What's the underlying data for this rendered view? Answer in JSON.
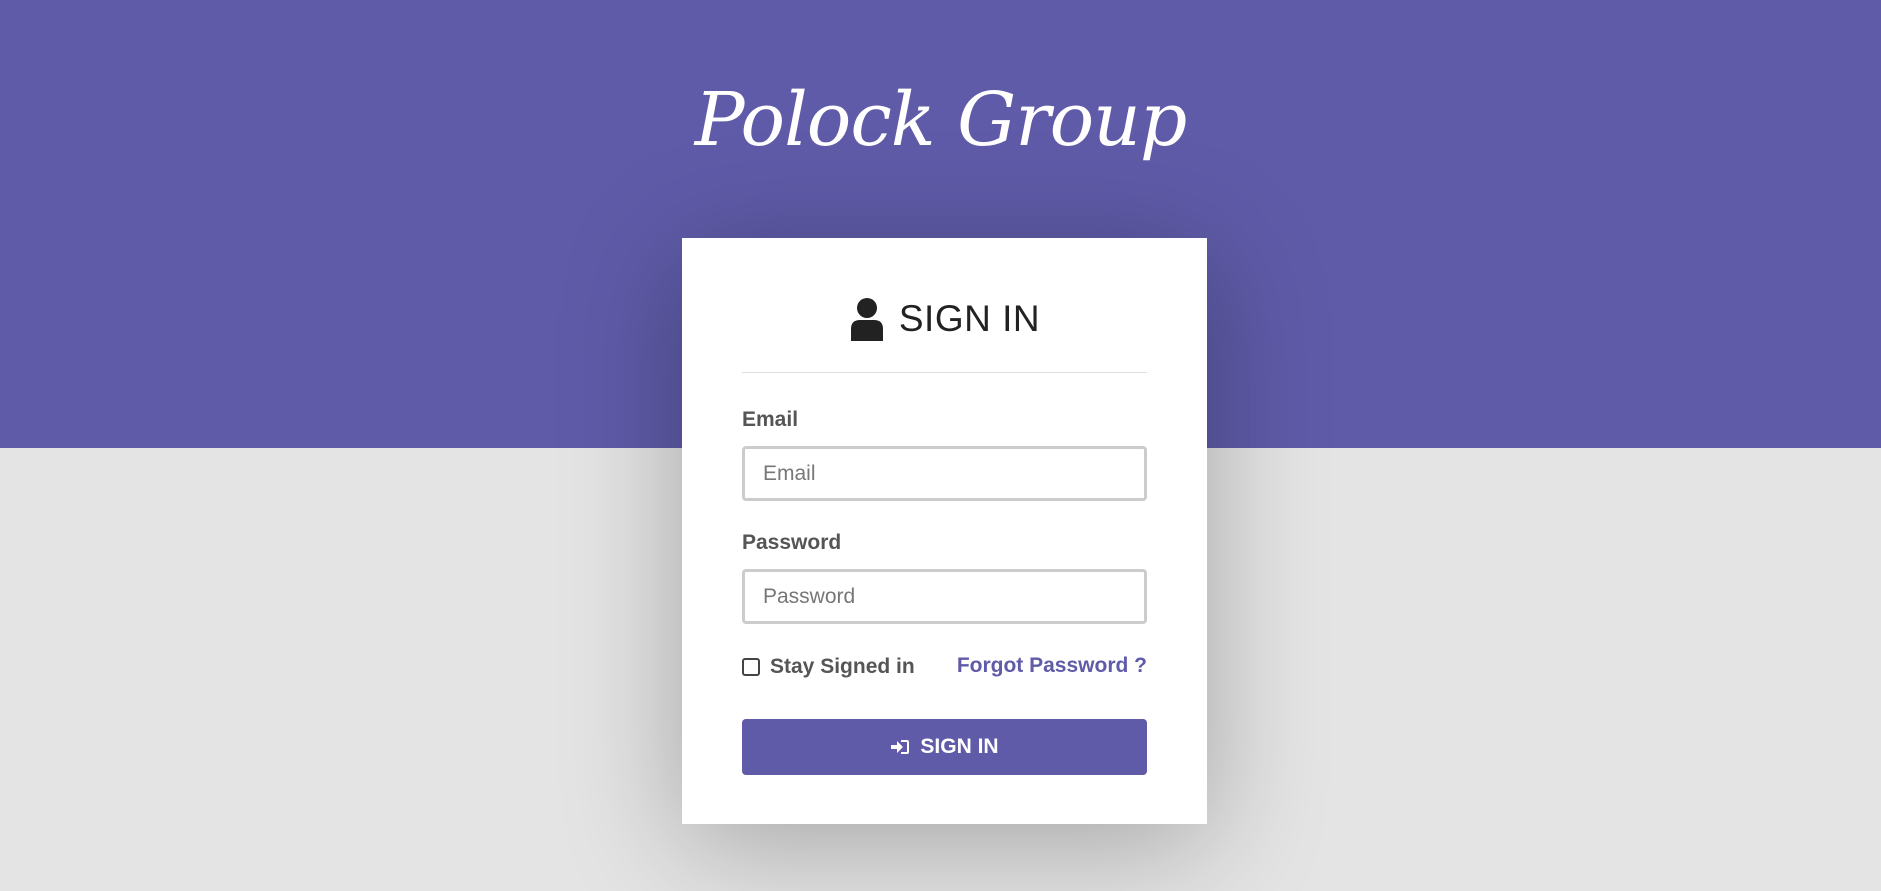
{
  "brand": {
    "name": "Polock Group"
  },
  "login_card": {
    "heading": "SIGN IN",
    "heading_icon": "user-icon",
    "email": {
      "label": "Email",
      "placeholder": "Email",
      "value": ""
    },
    "password": {
      "label": "Password",
      "placeholder": "Password",
      "value": ""
    },
    "remember": {
      "label": "Stay Signed in",
      "checked": false
    },
    "forgot_link": "Forgot Password ?",
    "submit": {
      "label": "SIGN IN",
      "icon": "sign-in-icon"
    }
  },
  "colors": {
    "brand_purple": "#5f5ba8",
    "page_gray": "#e4e4e4",
    "card_white": "#ffffff",
    "heading_text": "#222222",
    "label_text": "#555555"
  }
}
